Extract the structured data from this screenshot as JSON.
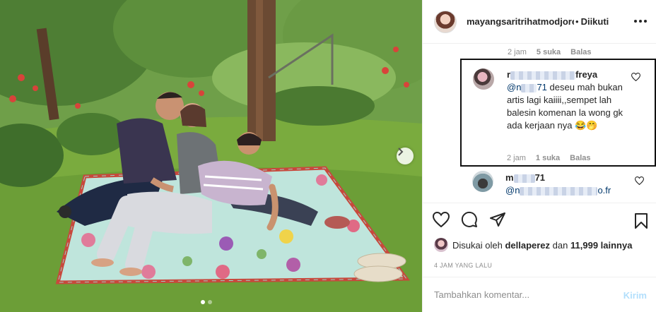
{
  "post": {
    "username": "mayangsaritrihatmodjore...",
    "follow_separator": "•",
    "follow_status": "Diikuti"
  },
  "comments": {
    "prev_meta": {
      "time": "2 jam",
      "likes": "5 suka",
      "reply": "Balas"
    },
    "reply": {
      "user_prefix": "r",
      "user_suffix": "freya",
      "mention_prefix": "@n",
      "mention_suffix": "71",
      "text": "deseu mah bukan artis lagi kaiiii,,sempet lah balesin komenan la wong gk ada kerjaan nya 😂🤭",
      "meta": {
        "time": "2 jam",
        "likes": "1 suka",
        "reply": "Balas"
      }
    },
    "next": {
      "user_prefix": "m",
      "user_suffix": "71",
      "mention_prefix": "@n",
      "mention_suffix": "o.fr"
    }
  },
  "likes": {
    "prefix": "Disukai oleh",
    "user": "dellaperez",
    "joiner": "dan",
    "others": "11,999 lainnya"
  },
  "time_ago": "4 JAM YANG LALU",
  "comment_box": {
    "placeholder": "Tambahkan komentar...",
    "post_label": "Kirim"
  },
  "carousel": {
    "total": 2,
    "active": 1
  },
  "icons": {
    "options": "more-horizontal-icon",
    "like": "heart-icon",
    "comment": "comment-bubble-icon",
    "share": "paper-plane-icon",
    "save": "bookmark-icon",
    "next": "chevron-right-icon"
  },
  "colors": {
    "text": "#262626",
    "muted": "#8e8e8e",
    "mention": "#00376b",
    "post_disabled": "#b2dffc",
    "border": "#efefef"
  }
}
